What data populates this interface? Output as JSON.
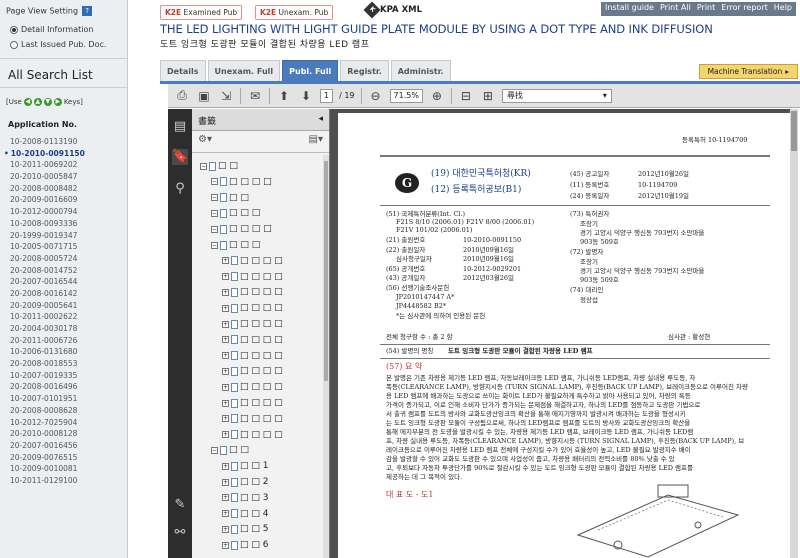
{
  "left": {
    "page_view_setting": "Page View Setting",
    "help": "?",
    "opt_detail": "Detail Information",
    "opt_last": "Last Issued Pub. Doc.",
    "all_search_list": "All Search List",
    "use_prefix": "[Use",
    "use_suffix": "Keys]",
    "app_no_label": "Application No.",
    "apps": [
      "10-2008-0113190",
      "10-2010-0091150",
      "10-2011-0069202",
      "20-2010-0005847",
      "20-2008-0008482",
      "20-2009-0016609",
      "10-2012-0000794",
      "10-2008-0093336",
      "20-1999-0019347",
      "10-2005-0071715",
      "20-2008-0005724",
      "20-2008-0014752",
      "20-2007-0016544",
      "20-2008-0016142",
      "20-2009-0005641",
      "10-2011-0002622",
      "20-2004-0030178",
      "20-2011-0006726",
      "10-2006-0131680",
      "20-2008-0018553",
      "10-2007-0019335",
      "20-2008-0016496",
      "10-2007-0101951",
      "20-2008-0008628",
      "10-2012-7025904",
      "20-2010-0008128",
      "20-2007-0016456",
      "20-2009-0076515",
      "10-2009-0010081",
      "10-2011-0129100"
    ],
    "selected_index": 1
  },
  "top": {
    "k2e_examined": "Examined Pub",
    "k2e_unexam": "Unexam. Pub",
    "k2e": "K2E",
    "kpa_xml": "KPA XML",
    "links": [
      "Install guide",
      "Print All",
      "Print",
      "Error report",
      "Help"
    ]
  },
  "title": {
    "en": "THE LED LIGHTING WITH LIGHT GUIDE PLATE MODULE BY USING A DOT TYPE AND INK DIFFUSION",
    "ko": "도트 잉크형 도광판 모듈이 결합된 차량용 LED 램프"
  },
  "tabs": [
    {
      "label": "Details"
    },
    {
      "label": "Unexam. Full"
    },
    {
      "label": "Publ. Full"
    },
    {
      "label": "Registr."
    },
    {
      "label": "Administr."
    }
  ],
  "active_tab": 2,
  "machine_translation": "Machine Translation",
  "pdf": {
    "page": "1",
    "page_total": "/ 19",
    "zoom": "71.5%",
    "search_placeholder": "尋找"
  },
  "bm": {
    "title": "書籤",
    "items": [
      "□ □",
      "□ □ □ □",
      "□ □",
      "□ □ □",
      "□ □ □ □",
      "□ □ □",
      "□ □ □ □",
      "□ □ □ □",
      "□ □ □ □",
      "□ □ □ □",
      "□ □ □ □",
      "□ □ □ □",
      "□ □ □ □",
      "□ □ □ □",
      "□ □ □ □",
      "□ □ □ □",
      "□ □ □ □",
      "□ □ □ □",
      "□ □",
      "□ □ 1",
      "□ □ 2",
      "□ □ 3",
      "□ □ 4",
      "□ □ 5",
      "□ □ 6"
    ]
  },
  "doc": {
    "reg_no": "등록특허 10-1194709",
    "office": "(19) 대한민국특허청(KR)",
    "pubtype": "(12) 등록특허공보(B1)",
    "f45": "(45) 공고일자",
    "f45v": "2012년10월26일",
    "f11": "(11) 등록번호",
    "f11v": "10-1194709",
    "f24": "(24) 등록일자",
    "f24v": "2012년10월19일",
    "f51": "(51) 국제특허분류(Int. Cl.)",
    "ipc1": "F21S 8/10 (2006.01)   F21V 8/00 (2006.01)",
    "ipc2": "F21V 101/02 (2006.01)",
    "f21": "(21) 출원번호",
    "f21v": "10-2010-0091150",
    "f22": "(22) 출원일자",
    "f22v": "2010년09월16일",
    "f22b": "심사청구일자",
    "f22bv": "2010년09월16일",
    "f65": "(65) 공개번호",
    "f65v": "10-2012-0029201",
    "f43": "(43) 공개일자",
    "f43v": "2012년03월26일",
    "f56": "(56) 선행기술조사문헌",
    "f56a": "JP2010147447 A*",
    "f56b": "JP4448582 B2*",
    "f56c": "*는 심사관에 의하여 인용된 문헌",
    "f73": "(73) 특허권자",
    "f73v": "조장기",
    "f73a": "경기 고양시 덕양구 행신동   793번지 소만마을",
    "f73b": "903동 509호",
    "f72": "(72) 발명자",
    "f72v": "조장기",
    "f72a": "경기 고양시 덕양구 행신동   793번지 소만마을",
    "f72b": "903동 509호",
    "f74": "(74) 대리인",
    "f74v": "정상섭",
    "claims": "전체 청구항 수 : 총 2 항",
    "examiner": "심사관 : 황성현",
    "f54": "(54) 발명의 명칭",
    "f54v": "도트 잉크형 도광판 모듈이 결합된 차량용 LED 램프",
    "f57": "(57) 요 약",
    "abstract": [
      "본 발명은 기존 차량용 제기등 LED 램프, 자동브레이크등 LED 램프, 가니쉬등 LED램프, 차량 실내용 루도등, 자",
      "폭등(CLEARANCE LAMP), 방향지시등 (TURN SIGNAL LAMP), 후진등(BACK UP LAMP), 보레이크등으로 이루어진 차량",
      "용 LED 램프에 배과하는 도광으로 쓰이는 화이트 LED가 불필요하게 특수하고 밝아 사용되고 있어, 차량의 특등",
      "가격이 증가되고, 이로 인해 소비자 단가가 증가되는 문제점을 해결하고자, 하나의 LED를 점등하고 도광판 기법으로",
      "서 출귀 램프를 도트의 방사와 교화도광산잉크의 확산을 통해 에지기영까지 발광시켜 배과하는 도광을 형성시키",
      "는 도트 잉크형 도광판 모듈이 구성됨으로써, 하나의 LED램프로 램프를 도트의 방사와 교화도광산잉크의 확산을",
      "통해 에지부분의 전 도광을 발광시킬 수 있는, 차량용 제기등 LED 램프, 브레이크등 LED 램프, 가니쉬등 LED램",
      "프, 차량 실내용 루도등, 자폭등(CLEARANCE LAMP), 방향지시등 (TURN SIGNAL LAMP), 후진등(BACK UP LAMP), 브",
      "레이크등으로 이루어진 차량용 LED 램프 전체에 구성지킬 수가 있어 효율성이 높고, LED 불필요 발광지수 배이",
      "감을 발광할 수 있어 교화도 도광판 수 있으며 사업성이 줍고, 차량용 배터리의 전력소비를 80% 낮출 수 있",
      "고, 후퇴보다 자동차 투광단가를 90%로 절감시킬 수 있는 도트 잉크형 도광판 모듈이 결합된 차량용 LED 램프를",
      "제공하는 데 그 목적이 있다."
    ],
    "rep": "대 표 도 - 도1"
  }
}
